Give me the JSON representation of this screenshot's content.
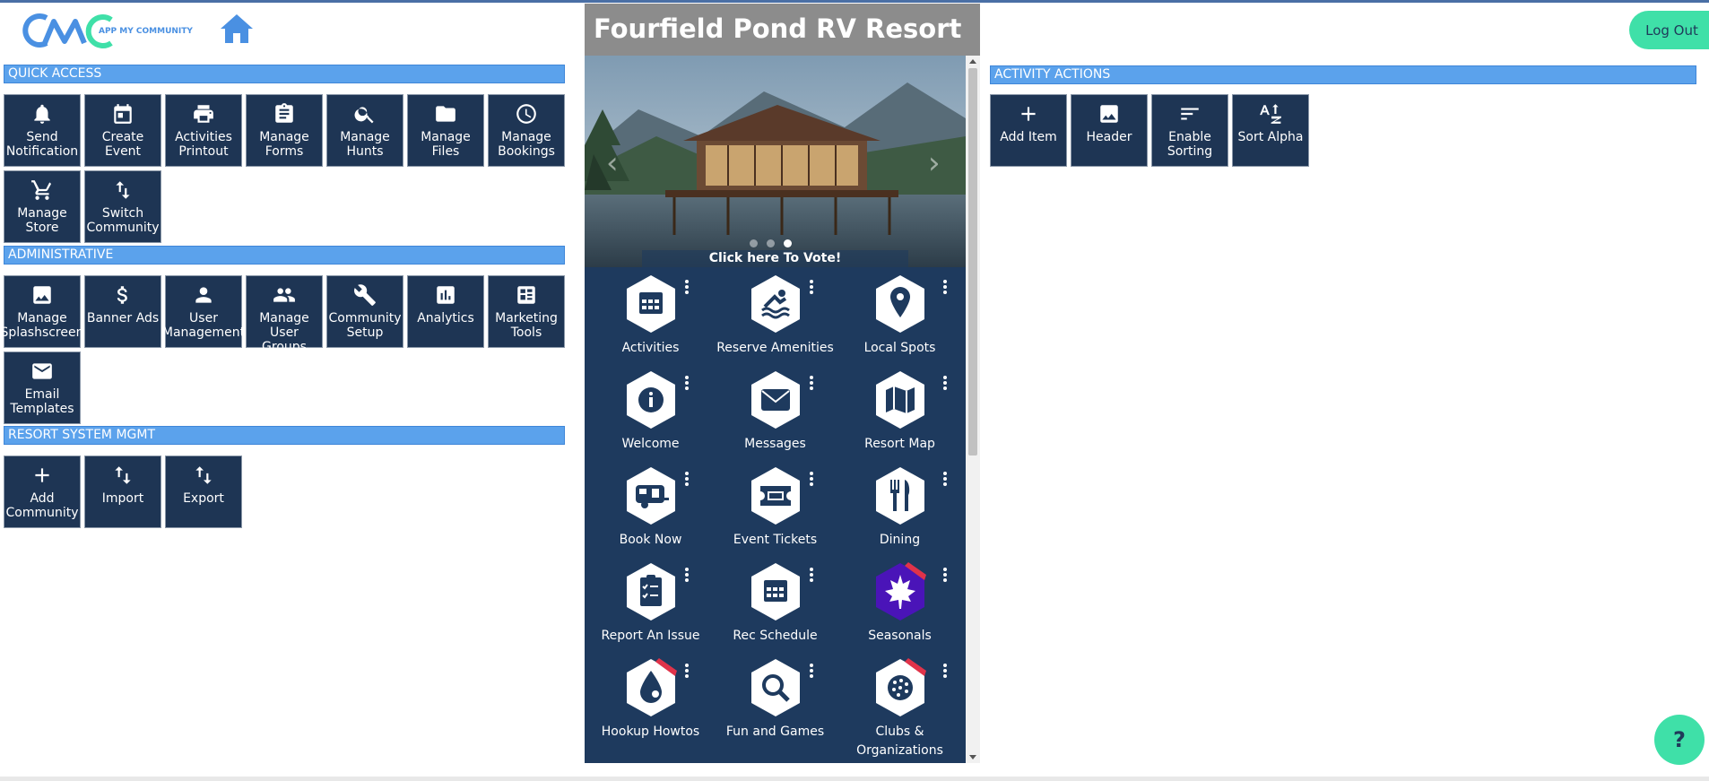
{
  "header": {
    "logo_text": "APP MY COMMUNITY",
    "logout_label": "Log Out"
  },
  "sections": {
    "quick_access": "QUICK ACCESS",
    "administrative": "ADMINISTRATIVE",
    "resort": "RESORT SYSTEM MGMT",
    "activity": "ACTIVITY ACTIONS"
  },
  "quick_access": [
    {
      "label": "Send\nNotification",
      "icon": "bell-icon"
    },
    {
      "label": "Create\nEvent",
      "icon": "calendar-icon"
    },
    {
      "label": "Activities\nPrintout",
      "icon": "printer-icon"
    },
    {
      "label": "Manage\nForms",
      "icon": "clipboard-icon"
    },
    {
      "label": "Manage\nHunts",
      "icon": "search-icon"
    },
    {
      "label": "Manage\nFiles",
      "icon": "folder-icon"
    },
    {
      "label": "Manage\nBookings",
      "icon": "clock-icon"
    },
    {
      "label": "Manage\nStore",
      "icon": "cart-icon"
    },
    {
      "label": "Switch\nCommunity",
      "icon": "swap-icon"
    }
  ],
  "administrative": [
    {
      "label": "Manage\nSplashscreen",
      "icon": "image-icon"
    },
    {
      "label": "Banner Ads",
      "icon": "dollar-icon"
    },
    {
      "label": "User\nManagement",
      "icon": "person-icon"
    },
    {
      "label": "Manage\nUser Groups",
      "icon": "group-icon"
    },
    {
      "label": "Community\nSetup",
      "icon": "wrench-icon"
    },
    {
      "label": "Analytics",
      "icon": "chart-icon"
    },
    {
      "label": "Marketing\nTools",
      "icon": "dashboard-icon"
    },
    {
      "label": "Email\nTemplates",
      "icon": "mail-icon"
    }
  ],
  "resort": [
    {
      "label": "Add\nCommunity",
      "icon": "plus-icon"
    },
    {
      "label": "Import",
      "icon": "import-icon"
    },
    {
      "label": "Export",
      "icon": "export-icon"
    }
  ],
  "activity": [
    {
      "label": "Add Item",
      "icon": "plus-icon"
    },
    {
      "label": "Header",
      "icon": "image-icon"
    },
    {
      "label": "Enable\nSorting",
      "icon": "sort-icon"
    },
    {
      "label": "Sort Alpha",
      "icon": "sort-alpha-icon"
    }
  ],
  "phone": {
    "title": "Fourfield Pond RV Resort",
    "vote_label": "Click here To Vote!",
    "apps": [
      {
        "label": "Activities",
        "icon": "calendar-icon"
      },
      {
        "label": "Reserve Amenities",
        "icon": "swimmer-icon"
      },
      {
        "label": "Local Spots",
        "icon": "map-pin-icon"
      },
      {
        "label": "Welcome",
        "icon": "info-icon"
      },
      {
        "label": "Messages",
        "icon": "envelope-icon"
      },
      {
        "label": "Resort Map",
        "icon": "map-icon"
      },
      {
        "label": "Book Now",
        "icon": "camper-icon"
      },
      {
        "label": "Event Tickets",
        "icon": "ticket-icon"
      },
      {
        "label": "Dining",
        "icon": "fork-knife-icon"
      },
      {
        "label": "Report An Issue",
        "icon": "checklist-icon"
      },
      {
        "label": "Rec Schedule",
        "icon": "calendar-icon"
      },
      {
        "label": "Seasonals",
        "icon": "maple-leaf-icon"
      },
      {
        "label": "Hookup Howtos",
        "icon": "water-drop-icon"
      },
      {
        "label": "Fun and Games",
        "icon": "magnifier-icon"
      },
      {
        "label": "Clubs &\nOrganizations",
        "icon": "pickleball-icon"
      }
    ]
  },
  "help_label": "?",
  "colors": {
    "tile_bg": "#1e3554",
    "section_bar": "#5ba2ec",
    "accent_green": "#3fe0a8",
    "phone_bg": "#1e3a5e"
  }
}
